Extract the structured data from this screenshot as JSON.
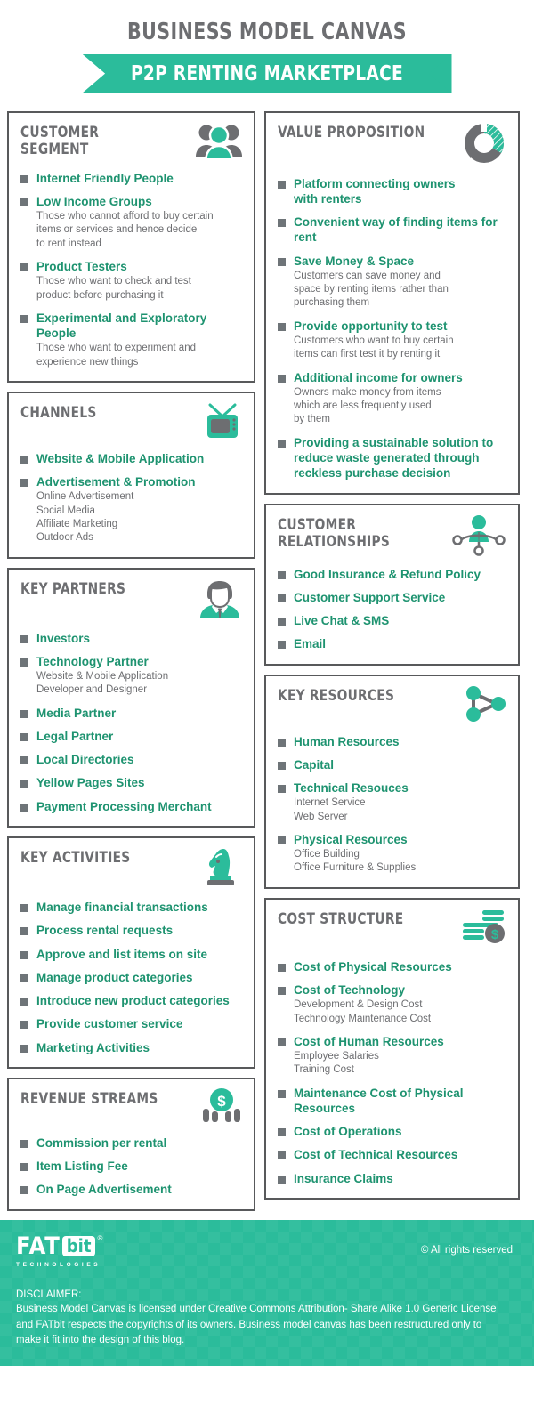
{
  "header": {
    "title": "Business Model Canvas",
    "subtitle": "P2P Renting Marketplace"
  },
  "colors": {
    "brand_green": "#2BBC9B",
    "text_green": "#1E9370",
    "heading_gray": "#6D6E71",
    "border_gray": "#58595B",
    "bullet_gray": "#6E7478"
  },
  "panels": {
    "customer_segment": {
      "title": "Customer Segment",
      "icon": "people-group-icon",
      "items": [
        {
          "label": "Internet Friendly People",
          "sub": []
        },
        {
          "label": "Low Income Groups",
          "sub": [
            "Those who cannot afford to buy certain",
            "items or services and hence decide",
            "to rent instead"
          ]
        },
        {
          "label": "Product Testers",
          "sub": [
            "Those who want to check and test",
            "product before purchasing it"
          ]
        },
        {
          "label": "Experimental and Exploratory People",
          "sub": [
            "Those who want to experiment and",
            "experience new things"
          ]
        }
      ]
    },
    "channels": {
      "title": "Channels",
      "icon": "television-icon",
      "items": [
        {
          "label": "Website & Mobile Application",
          "sub": []
        },
        {
          "label": "Advertisement & Promotion",
          "sub": [
            "Online Advertisement",
            "Social Media",
            "Affiliate Marketing",
            "Outdoor Ads"
          ]
        }
      ]
    },
    "key_partners": {
      "title": "Key Partners",
      "icon": "businessman-icon",
      "items": [
        {
          "label": "Investors",
          "sub": []
        },
        {
          "label": "Technology Partner",
          "sub": [
            "Website & Mobile Application",
            "Developer and Designer"
          ]
        },
        {
          "label": "Media Partner",
          "sub": []
        },
        {
          "label": "Legal Partner",
          "sub": []
        },
        {
          "label": "Local Directories",
          "sub": []
        },
        {
          "label": "Yellow Pages Sites",
          "sub": []
        },
        {
          "label": "Payment Processing Merchant",
          "sub": []
        }
      ]
    },
    "key_activities": {
      "title": "Key Activities",
      "icon": "chess-knight-icon",
      "items": [
        {
          "label": "Manage financial transactions",
          "sub": []
        },
        {
          "label": "Process rental requests",
          "sub": []
        },
        {
          "label": "Approve and list items on site",
          "sub": []
        },
        {
          "label": "Manage product categories",
          "sub": []
        },
        {
          "label": "Introduce new product categories",
          "sub": []
        },
        {
          "label": "Provide customer service",
          "sub": []
        },
        {
          "label": "Marketing Activities",
          "sub": []
        }
      ]
    },
    "revenue_streams": {
      "title": "Revenue Streams",
      "icon": "money-coin-people-icon",
      "items": [
        {
          "label": "Commission per rental",
          "sub": []
        },
        {
          "label": "Item Listing Fee",
          "sub": []
        },
        {
          "label": "On Page Advertisement",
          "sub": []
        }
      ]
    },
    "value_proposition": {
      "title": "Value Proposition",
      "icon": "donut-chart-icon",
      "items": [
        {
          "label": "Platform connecting owners with renters",
          "sub": []
        },
        {
          "label": "Convenient way of finding items for rent",
          "sub": []
        },
        {
          "label": "Save Money & Space",
          "sub": [
            "Customers can save money and",
            "space by renting items rather than",
            "purchasing them"
          ]
        },
        {
          "label": "Provide opportunity to test",
          "sub": [
            "Customers who want to buy certain",
            "items can first test it by renting it"
          ]
        },
        {
          "label": "Additional income for owners",
          "sub": [
            "Owners make money from items",
            "which are less frequently used",
            "by them"
          ]
        },
        {
          "label": "Providing a sustainable solution to reduce waste generated through reckless purchase decision",
          "sub": []
        }
      ]
    },
    "customer_relationships": {
      "title": "Customer Relationships",
      "icon": "network-person-icon",
      "items": [
        {
          "label": "Good Insurance & Refund Policy",
          "sub": []
        },
        {
          "label": "Customer Support Service",
          "sub": []
        },
        {
          "label": "Live Chat & SMS",
          "sub": []
        },
        {
          "label": "Email",
          "sub": []
        }
      ]
    },
    "key_resources": {
      "title": "Key Resources",
      "icon": "node-network-icon",
      "items": [
        {
          "label": "Human Resources",
          "sub": []
        },
        {
          "label": "Capital",
          "sub": []
        },
        {
          "label": "Technical Resouces",
          "sub": [
            "Internet Service",
            "Web Server"
          ]
        },
        {
          "label": "Physical Resources",
          "sub": [
            "Office Building",
            "Office Furniture & Supplies"
          ]
        }
      ]
    },
    "cost_structure": {
      "title": "Cost Structure",
      "icon": "coin-stack-icon",
      "items": [
        {
          "label": "Cost of Physical Resources",
          "sub": []
        },
        {
          "label": "Cost of Technology",
          "sub": [
            "Development & Design Cost",
            "Technology Maintenance Cost"
          ]
        },
        {
          "label": "Cost of Human Resources",
          "sub": [
            "Employee Salaries",
            "Training Cost"
          ]
        },
        {
          "label": "Maintenance Cost of Physical Resources",
          "sub": []
        },
        {
          "label": "Cost of Operations",
          "sub": []
        },
        {
          "label": "Cost of Technical Resources",
          "sub": []
        },
        {
          "label": "Insurance Claims",
          "sub": []
        }
      ]
    }
  },
  "footer": {
    "logo_fat": "FAT",
    "logo_bit": "bit",
    "logo_reg": "®",
    "logo_sub": "TECHNOLOGIES",
    "rights": "© All rights reserved",
    "disclaimer_label": "DISCLAIMER:",
    "disclaimer_text": "Business Model Canvas is licensed under Creative Commons Attribution- Share Alike 1.0 Generic License and FATbit respects the copyrights of its owners. Business model canvas has been restructured only to make it fit into the design of this blog."
  }
}
